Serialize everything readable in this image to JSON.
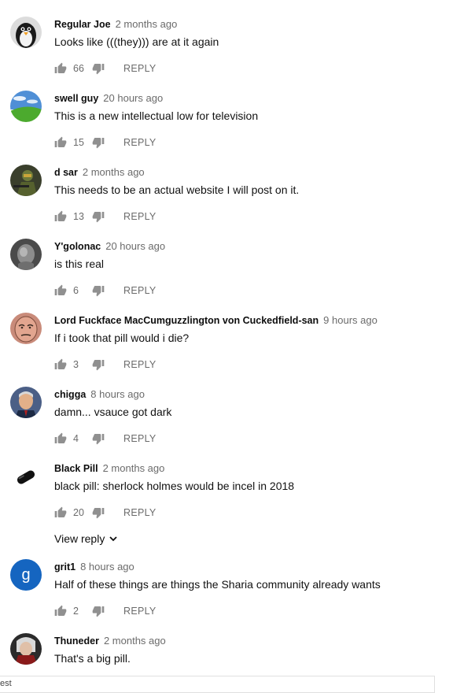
{
  "comments": [
    {
      "author": "Regular Joe",
      "time": "2 months ago",
      "text": "Looks like (((they))) are at it again",
      "likes": "66",
      "reply_label": "REPLY"
    },
    {
      "author": "swell guy",
      "time": "20 hours ago",
      "text": "This is a new intellectual low for television",
      "likes": "15",
      "reply_label": "REPLY"
    },
    {
      "author": "d sar",
      "time": "2 months ago",
      "text": "This needs to be an actual website I will post on it.",
      "likes": "13",
      "reply_label": "REPLY"
    },
    {
      "author": "Y'golonac",
      "time": "20 hours ago",
      "text": "is this real",
      "likes": "6",
      "reply_label": "REPLY"
    },
    {
      "author": "Lord Fuckface MacCumguzzlington von Cuckedfield-san",
      "time": "9 hours ago",
      "text": "If i took that pill would i die?",
      "likes": "3",
      "reply_label": "REPLY"
    },
    {
      "author": "chigga",
      "time": "8 hours ago",
      "text": "damn... vsauce got dark",
      "likes": "4",
      "reply_label": "REPLY"
    },
    {
      "author": "Black Pill",
      "time": "2 months ago",
      "text": "black pill: sherlock holmes would be incel in 2018",
      "likes": "20",
      "reply_label": "REPLY",
      "view_reply": "View reply"
    },
    {
      "author": "grit1",
      "time": "8 hours ago",
      "text": "Half of these things are things the Sharia community already wants",
      "likes": "2",
      "reply_label": "REPLY",
      "avatar_letter": "g"
    },
    {
      "author": "Thuneder",
      "time": "2 months ago",
      "text": "That's a big pill."
    }
  ],
  "bottom_bar": {
    "text": "est"
  },
  "colors": {
    "meta_gray": "#6b6b6b",
    "avatar_blue": "#1565c0"
  }
}
